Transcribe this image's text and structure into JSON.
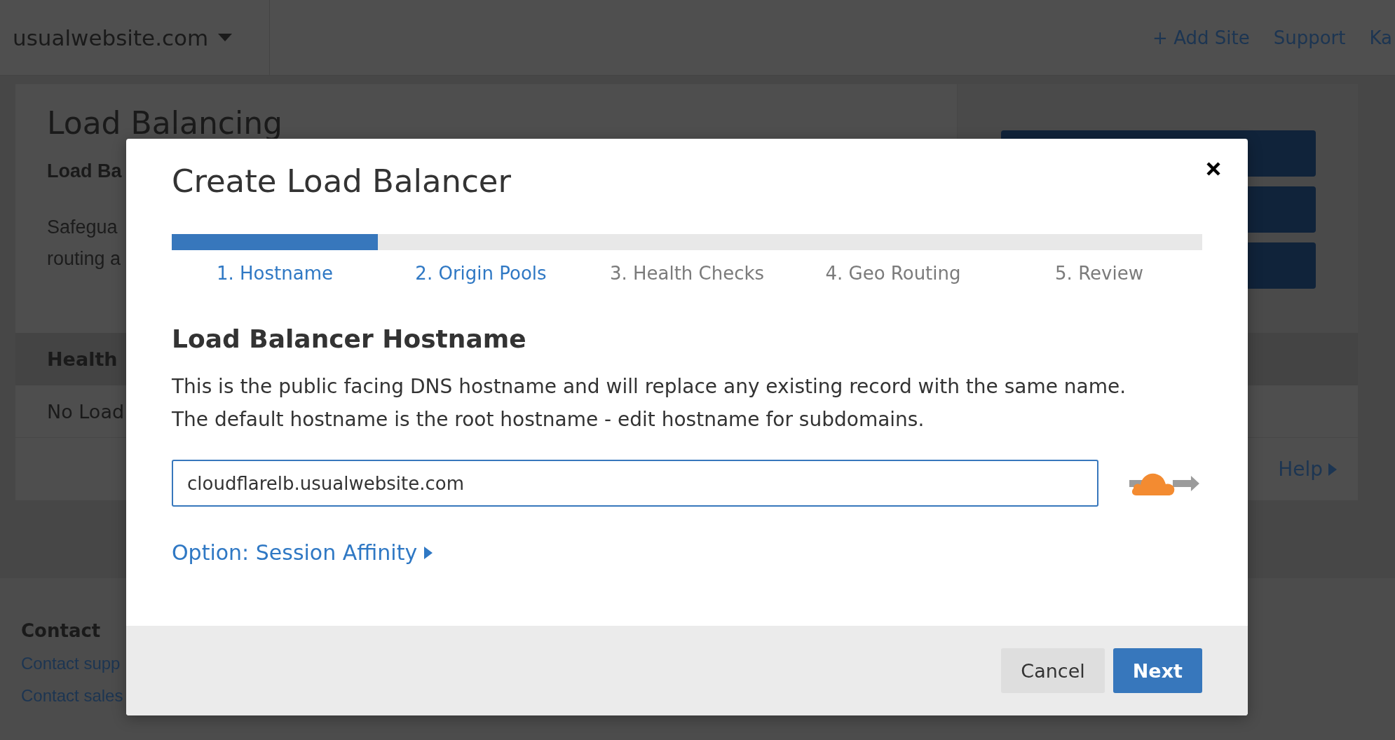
{
  "header": {
    "site": "usualwebsite.com",
    "links": [
      "+ Add Site",
      "Support",
      "Ka"
    ]
  },
  "page": {
    "title": "Load Balancing",
    "subtitle": "Load Ba",
    "intro": "Safegua\nrouting a",
    "health_heading": "Health",
    "empty_text": "No Load",
    "help_link": "Help"
  },
  "footer": {
    "heading": "Contact",
    "links": [
      "Contact supp",
      "Contact sales"
    ]
  },
  "modal": {
    "title": "Create Load Balancer",
    "progress": {
      "level": 0.2
    },
    "steps": [
      {
        "label": "1. Hostname",
        "enabled": true
      },
      {
        "label": "2. Origin Pools",
        "enabled": true
      },
      {
        "label": "3. Health Checks",
        "enabled": false
      },
      {
        "label": "4. Geo Routing",
        "enabled": false
      },
      {
        "label": "5. Review",
        "enabled": false
      }
    ],
    "heading": "Load Balancer Hostname",
    "description": "This is the public facing DNS hostname and will replace any existing record with the same name.\nThe default hostname is the root hostname - edit hostname for subdomains.",
    "hostname": {
      "value": "cloudflarelb.usualwebsite.com"
    },
    "option_link": "Option: Session Affinity",
    "buttons": [
      {
        "label": "Cancel",
        "kind": "secondary"
      },
      {
        "label": "Next",
        "kind": "primary"
      }
    ]
  }
}
